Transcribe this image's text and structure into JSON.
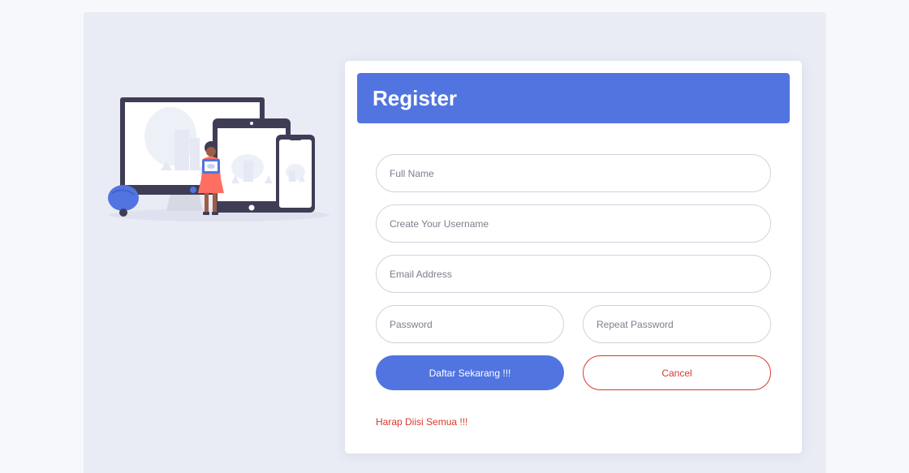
{
  "header": {
    "title": "Register"
  },
  "form": {
    "full_name": {
      "placeholder": "Full Name",
      "value": ""
    },
    "username": {
      "placeholder": "Create Your Username",
      "value": ""
    },
    "email": {
      "placeholder": "Email Address",
      "value": ""
    },
    "password": {
      "placeholder": "Password",
      "value": ""
    },
    "repeat_password": {
      "placeholder": "Repeat Password",
      "value": ""
    }
  },
  "buttons": {
    "submit_label": "Daftar Sekarang !!!",
    "cancel_label": "Cancel"
  },
  "message": {
    "warning": "Harap Diisi Semua !!!"
  },
  "colors": {
    "primary": "#5174e0",
    "danger": "#d63a2a",
    "panel_bg": "#e9ecf4",
    "page_bg": "#f7f8fc"
  },
  "illustration": {
    "icon": "devices-illustration"
  }
}
